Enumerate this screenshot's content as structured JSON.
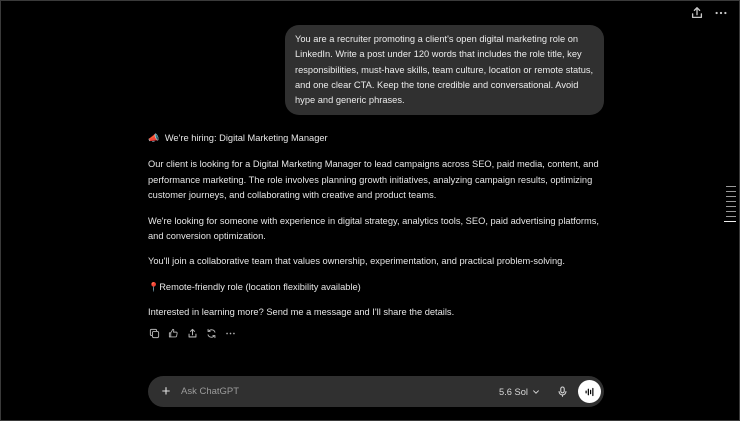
{
  "top_actions": {
    "share_icon": "share-icon",
    "more_icon": "more-horizontal-icon"
  },
  "user_message": {
    "text": "You are a recruiter promoting a client's open digital marketing role on LinkedIn. Write a post under 120 words that includes the role title, key responsibilities, must-have skills, team culture, location or remote status, and one clear CTA. Keep the tone credible and conversational. Avoid hype and generic phrases."
  },
  "assistant_message": {
    "heading_emoji": "📣",
    "heading": "We're hiring: Digital Marketing Manager",
    "paragraphs": [
      "Our client is looking for a Digital Marketing Manager to lead campaigns across SEO, paid media, content, and performance marketing. The role involves planning growth initiatives, analyzing campaign results, optimizing customer journeys, and collaborating with creative and product teams.",
      "We're looking for someone with experience in digital strategy, analytics tools, SEO, paid advertising platforms, and conversion optimization.",
      "You'll join a collaborative team that values ownership, experimentation, and practical problem-solving."
    ],
    "location_emoji": "📍",
    "location": "Remote-friendly role (location flexibility available)",
    "cta": "Interested in learning more? Send me a message and I'll share the details."
  },
  "message_actions": [
    "copy-icon",
    "thumbs-icon",
    "share-icon",
    "regenerate-icon",
    "more-horizontal-icon"
  ],
  "composer": {
    "placeholder": "Ask ChatGPT",
    "model_label": "5.6 Sol",
    "plus_icon": "plus-icon",
    "mic_icon": "microphone-icon",
    "voice_icon": "voice-mode-icon"
  },
  "colors": {
    "background": "#000000",
    "bubble": "#303030",
    "text": "#ececec",
    "voice_button": "#ffffff"
  }
}
